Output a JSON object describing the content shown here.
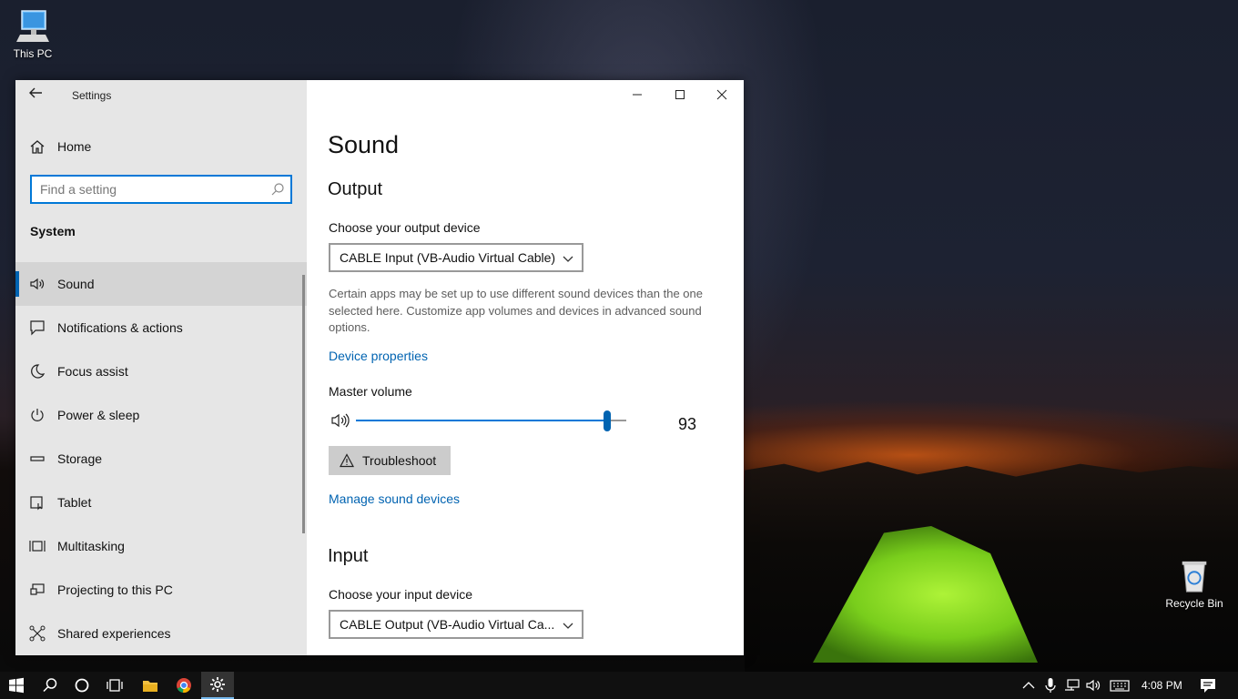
{
  "desktop": {
    "icons": [
      {
        "label": "This PC"
      },
      {
        "label": "Recycle Bin"
      }
    ]
  },
  "window": {
    "app_title": "Settings",
    "controls": {
      "minimize": "minimize-icon",
      "maximize": "maximize-icon",
      "close": "close-icon"
    }
  },
  "nav": {
    "home_label": "Home",
    "search": {
      "placeholder": "Find a setting"
    },
    "section_label": "System",
    "items": [
      {
        "label": "Sound",
        "icon": "speaker-icon",
        "selected": true
      },
      {
        "label": "Notifications & actions",
        "icon": "notification-icon",
        "selected": false
      },
      {
        "label": "Focus assist",
        "icon": "moon-icon",
        "selected": false
      },
      {
        "label": "Power & sleep",
        "icon": "power-icon",
        "selected": false
      },
      {
        "label": "Storage",
        "icon": "storage-icon",
        "selected": false
      },
      {
        "label": "Tablet",
        "icon": "tablet-icon",
        "selected": false
      },
      {
        "label": "Multitasking",
        "icon": "multitasking-icon",
        "selected": false
      },
      {
        "label": "Projecting to this PC",
        "icon": "projector-icon",
        "selected": false
      },
      {
        "label": "Shared experiences",
        "icon": "shared-icon",
        "selected": false
      }
    ]
  },
  "content": {
    "title": "Sound",
    "output": {
      "heading": "Output",
      "device_label": "Choose your output device",
      "device_value": "CABLE Input (VB-Audio Virtual Cable)",
      "help_text": "Certain apps may be set up to use different sound devices than the one selected here. Customize app volumes and devices in advanced sound options.",
      "device_properties_link": "Device properties",
      "master_volume_label": "Master volume",
      "volume": 93,
      "volume_text": "93",
      "troubleshoot_label": "Troubleshoot",
      "manage_devices_link": "Manage sound devices"
    },
    "input": {
      "heading": "Input",
      "device_label": "Choose your input device",
      "device_value": "CABLE Output (VB-Audio Virtual Ca..."
    }
  },
  "taskbar": {
    "time": "4:08 PM",
    "accent": "#76b9ed"
  }
}
